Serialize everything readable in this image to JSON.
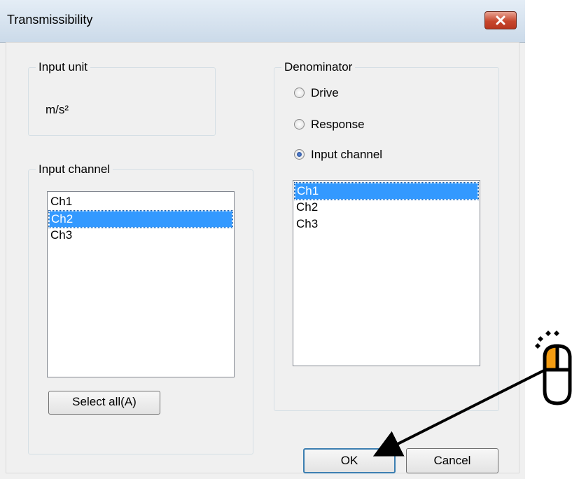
{
  "window": {
    "title": "Transmissibility"
  },
  "input_unit": {
    "label": "Input unit",
    "value": "m/s²"
  },
  "input_channel": {
    "label": "Input channel",
    "items": [
      "Ch1",
      "Ch2",
      "Ch3"
    ],
    "selected": "Ch2",
    "select_all_label": "Select all(A)"
  },
  "denominator": {
    "label": "Denominator",
    "options": [
      "Drive",
      "Response",
      "Input channel"
    ],
    "selected_option": "Input channel",
    "list_items": [
      "Ch1",
      "Ch2",
      "Ch3"
    ],
    "list_selected": "Ch1"
  },
  "buttons": {
    "ok_label": "OK",
    "cancel_label": "Cancel"
  },
  "colors": {
    "selection": "#3399ff",
    "cursor_accent": "#f39c12",
    "close_button": "#c7472d"
  }
}
